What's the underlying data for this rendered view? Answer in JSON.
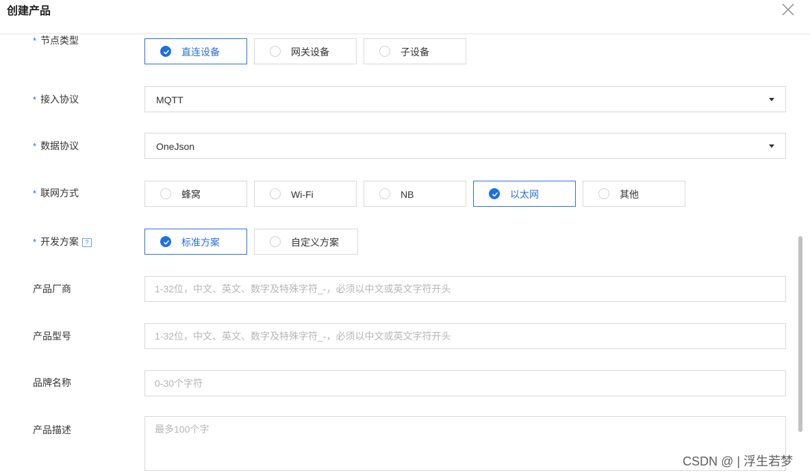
{
  "dialog": {
    "title": "创建产品",
    "close_label": "×"
  },
  "form": {
    "node_type": {
      "label": "节点类型",
      "options": [
        "直连设备",
        "网关设备",
        "子设备"
      ],
      "selected": "直连设备"
    },
    "access_protocol": {
      "label": "接入协议",
      "value": "MQTT"
    },
    "data_protocol": {
      "label": "数据协议",
      "value": "OneJson"
    },
    "network_mode": {
      "label": "联网方式",
      "options": [
        "蜂窝",
        "Wi-Fi",
        "NB",
        "以太网",
        "其他"
      ],
      "selected": "以太网"
    },
    "dev_plan": {
      "label": "开发方案",
      "help_icon": "?",
      "options": [
        "标准方案",
        "自定义方案"
      ],
      "selected": "标准方案"
    },
    "manufacturer": {
      "label": "产品厂商",
      "placeholder": "1-32位，中文、英文、数字及特殊字符_-，必须以中文或英文字符开头"
    },
    "model": {
      "label": "产品型号",
      "placeholder": "1-32位，中文、英文、数字及特殊字符_-，必须以中文或英文字符开头"
    },
    "brand": {
      "label": "品牌名称",
      "placeholder": "0-30个字符"
    },
    "description": {
      "label": "产品描述",
      "placeholder": "最多100个字"
    },
    "required_mark": "*"
  },
  "watermark": "CSDN @ | 浮生若梦",
  "colors": {
    "accent": "#1e6fe0",
    "required": "#1f6ad8",
    "border": "#d9d9d9",
    "placeholder": "#b5b5b5"
  }
}
